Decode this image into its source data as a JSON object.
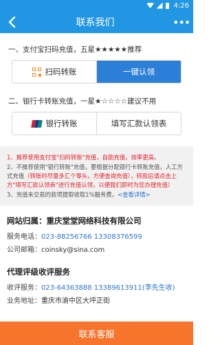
{
  "status_bar": {
    "time": "4:26"
  },
  "toolbar": {
    "title": "联系我们",
    "more": "•••"
  },
  "section1": {
    "title": "一、支付宝扫码充值，五星★★★★★推荐",
    "btn_scan": "扫码转账",
    "btn_claim": "一键认领"
  },
  "section2": {
    "title": "二、银行卡转账充值，一星★☆☆☆☆建议不用",
    "btn_bank": "银行转账",
    "btn_form": "填写汇款认领表"
  },
  "notes": {
    "n1_red": "1、推荐使用支付宝\"扫码转账\"充值，自助充值，效率更高。",
    "n2_plain": "2、不推荐使用\"银行转账\"充值，要根据分配银行卡转账充值，人工方式充值",
    "n2_red": "（转账时尽量多汇个零头，方便查询充值），转款后请点击上方\"填写汇款认领表\"进行充值认领，以便我们即时为您办理充值）",
    "n3_plain": "3、充值未交易的款项提取收取1%服务费。",
    "n3_link": "<查看详情>"
  },
  "company": {
    "label": "网站归属：",
    "name": "重庆堂堂网络科技有限公司",
    "phone_label": "服务电话：",
    "phone": "023-88256766 13308376599",
    "email_label": "公司邮箱：",
    "email": "coinsky@sina.com"
  },
  "agency": {
    "title": "代理评级收评服务",
    "row_label": "收评服务：",
    "row_value": "023-64363888 13389613911(李先生收)",
    "row2_label": "业务地址：",
    "row2_value": "重庆市渝中区大坪正街"
  },
  "bottom_button": "联系客服"
}
